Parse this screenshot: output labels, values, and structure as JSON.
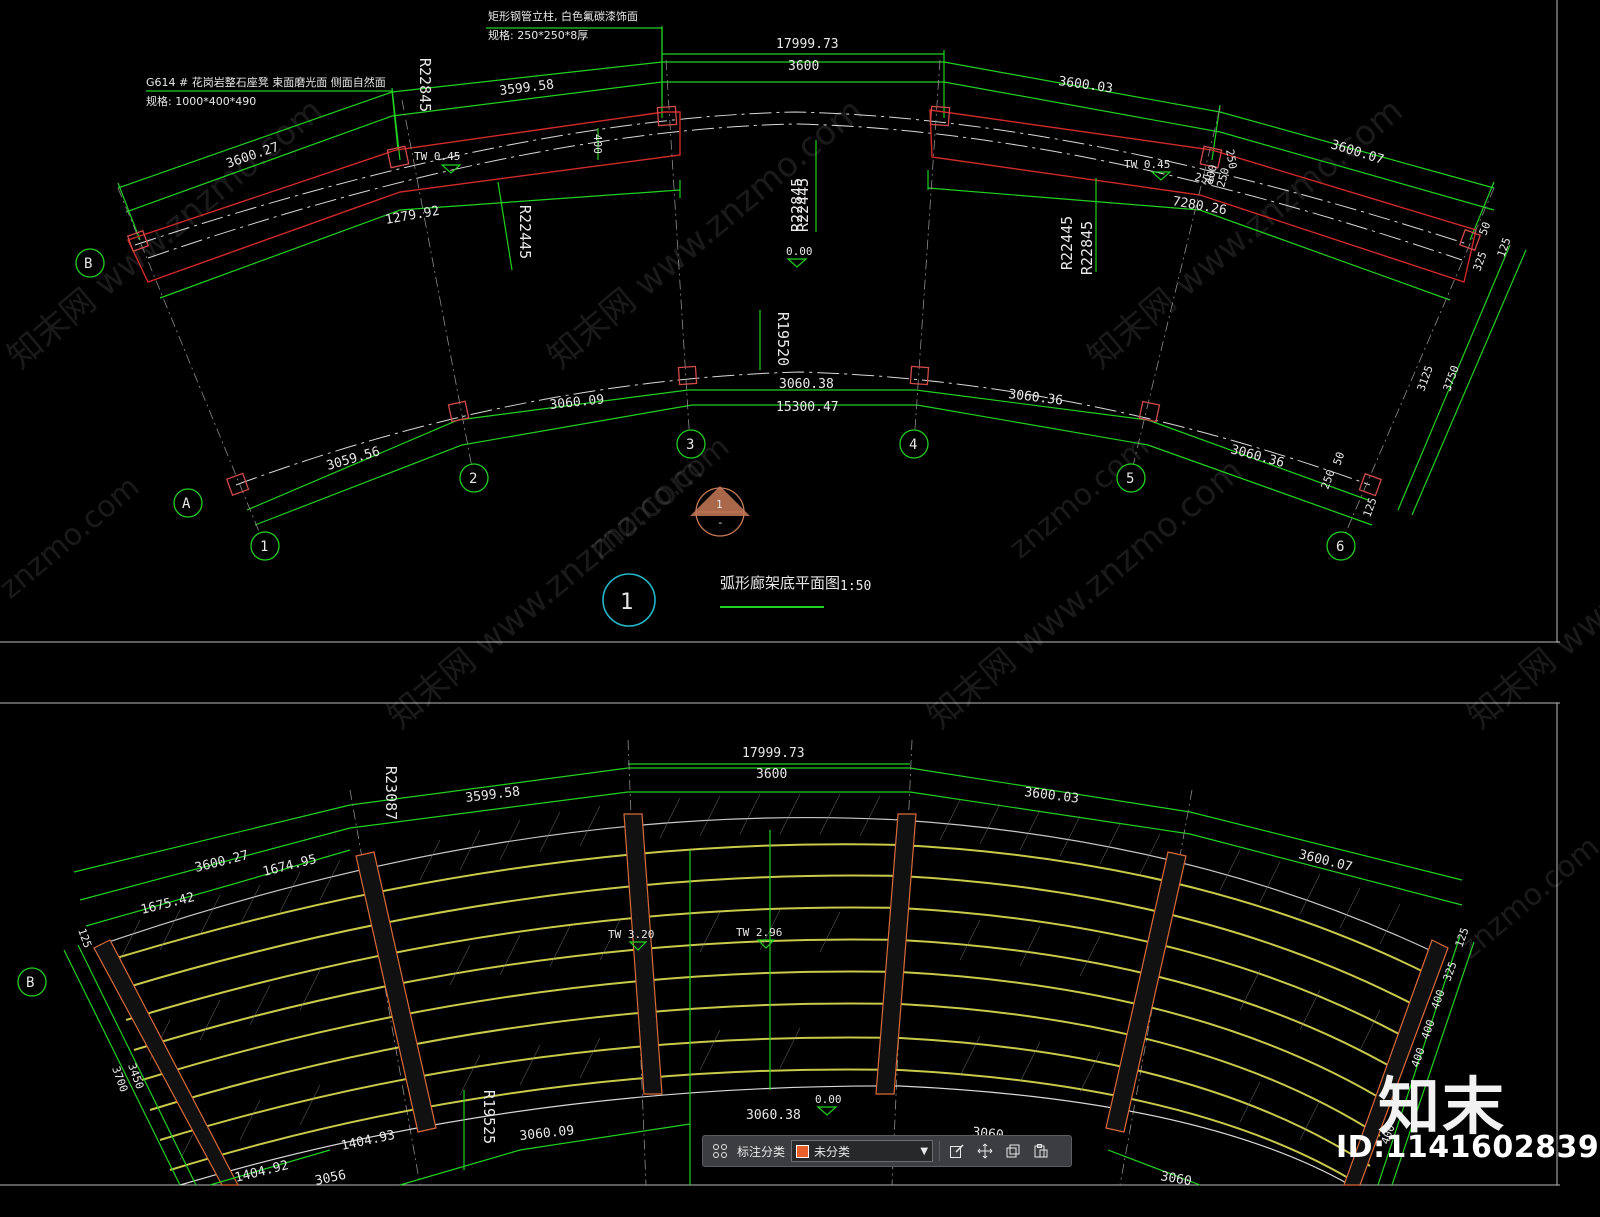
{
  "plan_top": {
    "annotation_left": {
      "line1": "G614 # 花岗岩整石座凳  束面磨光面  侧面自然面",
      "line2": "规格: 1000*400*490"
    },
    "annotation_top": {
      "line1": "矩形钢管立柱, 白色氟碳漆饰面",
      "line2": "规格: 250*250*8厚"
    },
    "dims_outer": [
      "17999.73",
      "3600",
      "3599.58",
      "3600.03",
      "3600.27",
      "3600.07"
    ],
    "dims_inner": [
      "1279.92",
      "7280.26",
      "15300.47",
      "3060.38",
      "3060.09",
      "3060.36",
      "3059.56",
      "3060.36"
    ],
    "radii": [
      "R22845",
      "R22445",
      "R22845",
      "R22445",
      "R22445",
      "R22845",
      "R19520"
    ],
    "levels": [
      "TW 0.45",
      "TW 0.45",
      "0.00"
    ],
    "small_dims": [
      "400",
      "250",
      "250",
      "400",
      "250",
      "50",
      "325",
      "125",
      "3125",
      "3750",
      "50",
      "250",
      "125"
    ],
    "grid_rows": [
      "B",
      "A"
    ],
    "grid_cols": [
      "1",
      "2",
      "3",
      "4",
      "5",
      "6"
    ],
    "section_marker": {
      "top": "1",
      "bottom": "-"
    },
    "drawing_number": "1",
    "drawing_title": "弧形廊架底平面图",
    "scale": "1:50"
  },
  "plan_bottom": {
    "dims_outer": [
      "17999.73",
      "3600",
      "3599.58",
      "3600.03",
      "3600.27",
      "3600.07",
      "1674.95",
      "1675.42"
    ],
    "radii": [
      "R23087",
      "R19525"
    ],
    "levels": [
      "TW 3.20",
      "TW 2.96",
      "0.00"
    ],
    "dims_inner": [
      "3060.38",
      "3060.09",
      "1404.93",
      "1404.92",
      "3060",
      "3060",
      "3056"
    ],
    "side_dims_left": [
      "125",
      "3450",
      "3700"
    ],
    "side_dims_right": [
      "125",
      "325",
      "400",
      "400",
      "400",
      "400"
    ],
    "grid_rows": [
      "B"
    ]
  },
  "watermarks": [
    "知末网 www.znzmo.com",
    "znzmo.com"
  ],
  "brand": {
    "logo_text": "知末",
    "id_text": "ID:1141602839"
  },
  "toolbar": {
    "grid_icon": "grid-icon",
    "category_label": "标注分类",
    "category_value": "未分类",
    "category_color": "#e9612a",
    "buttons": [
      "edit-icon",
      "move-icon",
      "copy-icon",
      "paste-icon"
    ]
  },
  "colors": {
    "background": "#000000",
    "dimension": "#22d022",
    "bench": "#d12a2a",
    "text": "#e8e8e8"
  }
}
